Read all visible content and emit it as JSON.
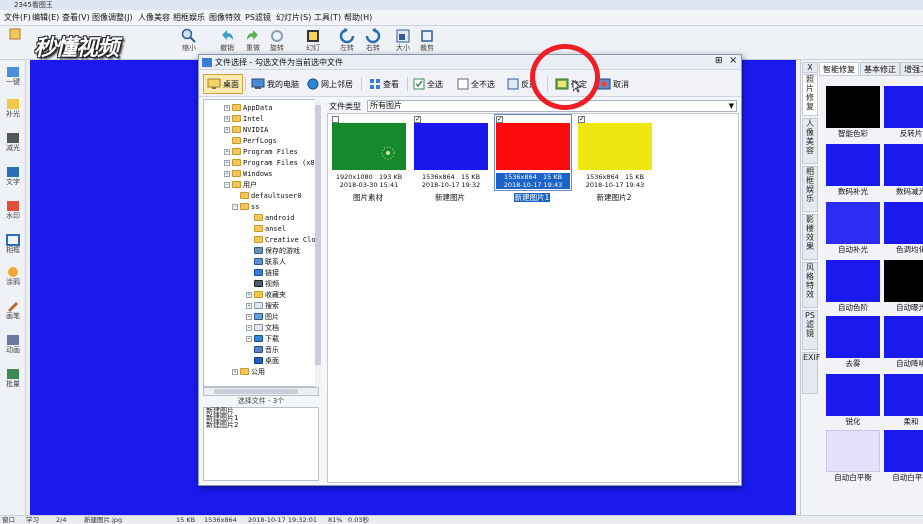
{
  "app": {
    "title": "2345看图王"
  },
  "menu": [
    "文件(F)",
    "编辑(E)",
    "查看(V)",
    "图像调整(J)",
    "人像美容",
    "相框娱乐",
    "图像特效",
    "PS滤镜",
    "幻灯片(S)",
    "工具(T)",
    "帮助(H)"
  ],
  "toolbar": {
    "watermark": "秒懂视频",
    "buttons": [
      "缩小",
      "撤销",
      "重做",
      "旋转",
      "幻灯",
      "左转",
      "右转",
      "大小",
      "裁剪"
    ]
  },
  "leftbar": [
    "一键",
    "补光",
    "减光",
    "文字",
    "水印",
    "相框",
    "涂鸦",
    "画笔",
    "动画",
    "批量"
  ],
  "dialog": {
    "title": "文件选择 - 勾选文件为当前选中文件",
    "buttons": {
      "desktop": "桌面",
      "my_computer": "我的电脑",
      "network": "网上邻居",
      "view": "查看",
      "select_all": "全选",
      "select_none": "全不选",
      "invert": "反选",
      "ok": "确定",
      "cancel": "取消"
    },
    "tree": [
      "AppData",
      "Intel",
      "NVIDIA",
      "PerfLogs",
      "Program Files",
      "Program Files (x86)",
      "Windows",
      "用户",
      "defaultuser0",
      "ss",
      "android",
      "ansel",
      "Creative Cloud",
      "保存的游戏",
      "联系人",
      "链接",
      "视频",
      "收藏夹",
      "搜索",
      "图片",
      "文档",
      "下载",
      "音乐",
      "桌面",
      "公用"
    ],
    "selected_header": "选择文件 - 3个",
    "selected_files": [
      "新建图片",
      "新建图片1",
      "新建图片2"
    ],
    "filetype_label": "文件类型",
    "filetype_value": "所有图片",
    "files": [
      {
        "name": "图片素材",
        "dims": "1920x1080",
        "size": "193 KB",
        "date": "2018-03-30 15:41",
        "color": "#158a2c",
        "checked": false,
        "selected": false
      },
      {
        "name": "新建图片",
        "dims": "1536x864",
        "size": "15 KB",
        "date": "2018-10-17 19:32",
        "color": "#1818ec",
        "checked": true,
        "selected": false
      },
      {
        "name": "新建图片1",
        "dims": "1536x864",
        "size": "15 KB",
        "date": "2018-10-17 19:43",
        "color": "#fa0a0a",
        "checked": true,
        "selected": true
      },
      {
        "name": "新建图片2",
        "dims": "1536x864",
        "size": "15 KB",
        "date": "2018-10-17 19:43",
        "color": "#f0e612",
        "checked": true,
        "selected": false
      }
    ]
  },
  "rightpanel": {
    "tabs": [
      "智能修复",
      "基本修正",
      "增强工具"
    ],
    "vtabs": [
      "X",
      "照片修复",
      "人像美容",
      "相框娱乐",
      "影楼效果",
      "风格特效",
      "PS滤镜",
      "EXIF"
    ],
    "effects": [
      {
        "label": "智能色彩",
        "color": "#000000"
      },
      {
        "label": "反转片",
        "color": "#1a1aef"
      },
      {
        "label": "数码补光",
        "color": "#1a1aef"
      },
      {
        "label": "数码减光",
        "color": "#1a1aef"
      },
      {
        "label": "自动补光",
        "color": "#2c2cf2"
      },
      {
        "label": "色调均化",
        "color": "#1a1aef"
      },
      {
        "label": "自动色阶",
        "color": "#1a1aef"
      },
      {
        "label": "自动曝光",
        "color": "#000000"
      },
      {
        "label": "去雾",
        "color": "#1a1aef"
      },
      {
        "label": "自动降噪",
        "color": "#1a1aef"
      },
      {
        "label": "锐化",
        "color": "#1a1aef"
      },
      {
        "label": "柔和",
        "color": "#1a1aef"
      },
      {
        "label": "自动白平衡",
        "color": "#e4e2fb"
      },
      {
        "label": "自动白平衡",
        "color": "#1a1aef"
      }
    ]
  },
  "status": {
    "mode": "窗口",
    "view": "学习",
    "page": "2/4",
    "filename": "新建图片.jpg",
    "size": "15 KB",
    "dims": "1536x864",
    "date": "2018-10-17 19:32:01",
    "zoom": "81%",
    "time": "0.03秒"
  },
  "colors": {
    "canvas": "#1a1aef",
    "annotation": "#ee1e24",
    "highlight": "#fbe9ad"
  }
}
